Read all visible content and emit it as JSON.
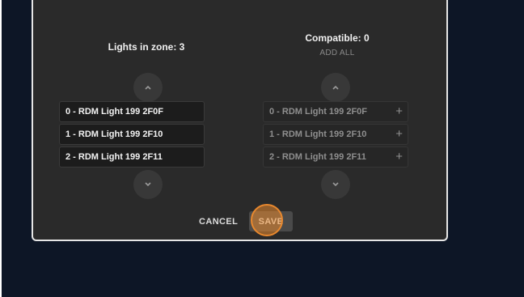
{
  "zone": {
    "title": "Lights in zone: 3",
    "items": [
      {
        "label": "0 - RDM Light 199 2F0F"
      },
      {
        "label": "1 - RDM Light 199 2F10"
      },
      {
        "label": "2 - RDM Light 199 2F11"
      }
    ]
  },
  "compatible": {
    "title": "Compatible: 0",
    "add_all_label": "ADD ALL",
    "items": [
      {
        "label": "0 - RDM Light 199 2F0F",
        "action": "+"
      },
      {
        "label": "1 - RDM Light 199 2F10",
        "action": "+"
      },
      {
        "label": "2 - RDM Light 199 2F11",
        "action": "+"
      }
    ]
  },
  "footer": {
    "cancel_label": "CANCEL",
    "save_label": "SAVE"
  },
  "icons": {
    "scroll_up": "chevron-up-icon",
    "scroll_down": "chevron-down-icon",
    "add": "plus-icon"
  },
  "colors": {
    "backdrop": "#0d1626",
    "dialog": "#2a2a2a",
    "click_highlight": "#e8882e"
  }
}
